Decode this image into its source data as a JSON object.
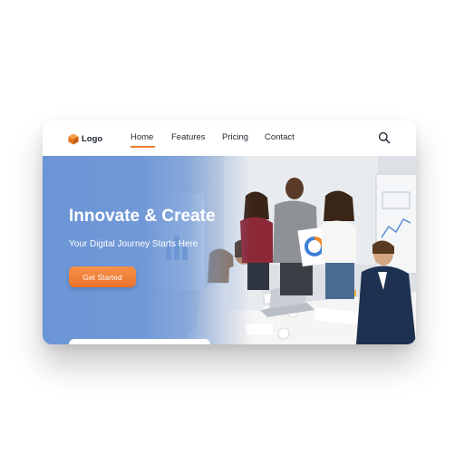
{
  "nav": {
    "logo_text": "Logo",
    "items": [
      {
        "label": "Home",
        "active": true
      },
      {
        "label": "Features"
      },
      {
        "label": "Pricing"
      },
      {
        "label": "Contact"
      }
    ],
    "search_icon": "search-icon"
  },
  "hero": {
    "title": "Innovate & Create",
    "subtitle": "Your Digital Journey Starts Here",
    "cta_label": "Get Started"
  },
  "colors": {
    "accent": "#ee7d2e",
    "hero_blue": "#6c95d6",
    "text_dark": "#1f2530"
  }
}
